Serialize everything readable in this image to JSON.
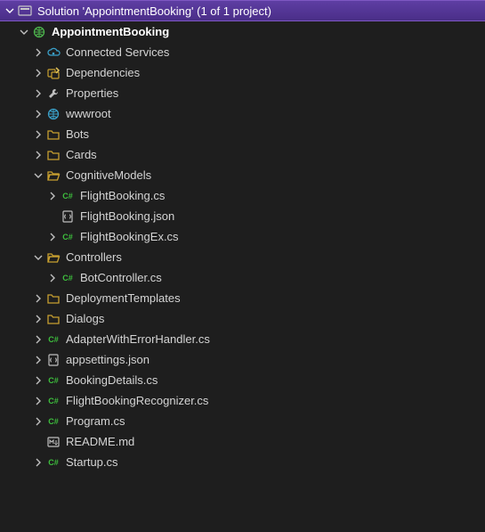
{
  "solution": {
    "title": "Solution 'AppointmentBooking' (1 of 1 project)",
    "project": "AppointmentBooking"
  },
  "nodes": {
    "connected_services": "Connected Services",
    "dependencies": "Dependencies",
    "properties": "Properties",
    "wwwroot": "wwwroot",
    "bots": "Bots",
    "cards": "Cards",
    "cognitive_models": "CognitiveModels",
    "flight_booking_cs": "FlightBooking.cs",
    "flight_booking_json": "FlightBooking.json",
    "flight_booking_ex_cs": "FlightBookingEx.cs",
    "controllers": "Controllers",
    "bot_controller_cs": "BotController.cs",
    "deployment_templates": "DeploymentTemplates",
    "dialogs": "Dialogs",
    "adapter_cs": "AdapterWithErrorHandler.cs",
    "appsettings_json": "appsettings.json",
    "booking_details_cs": "BookingDetails.cs",
    "flight_recognizer_cs": "FlightBookingRecognizer.cs",
    "program_cs": "Program.cs",
    "readme_md": "README.md",
    "startup_cs": "Startup.cs"
  }
}
